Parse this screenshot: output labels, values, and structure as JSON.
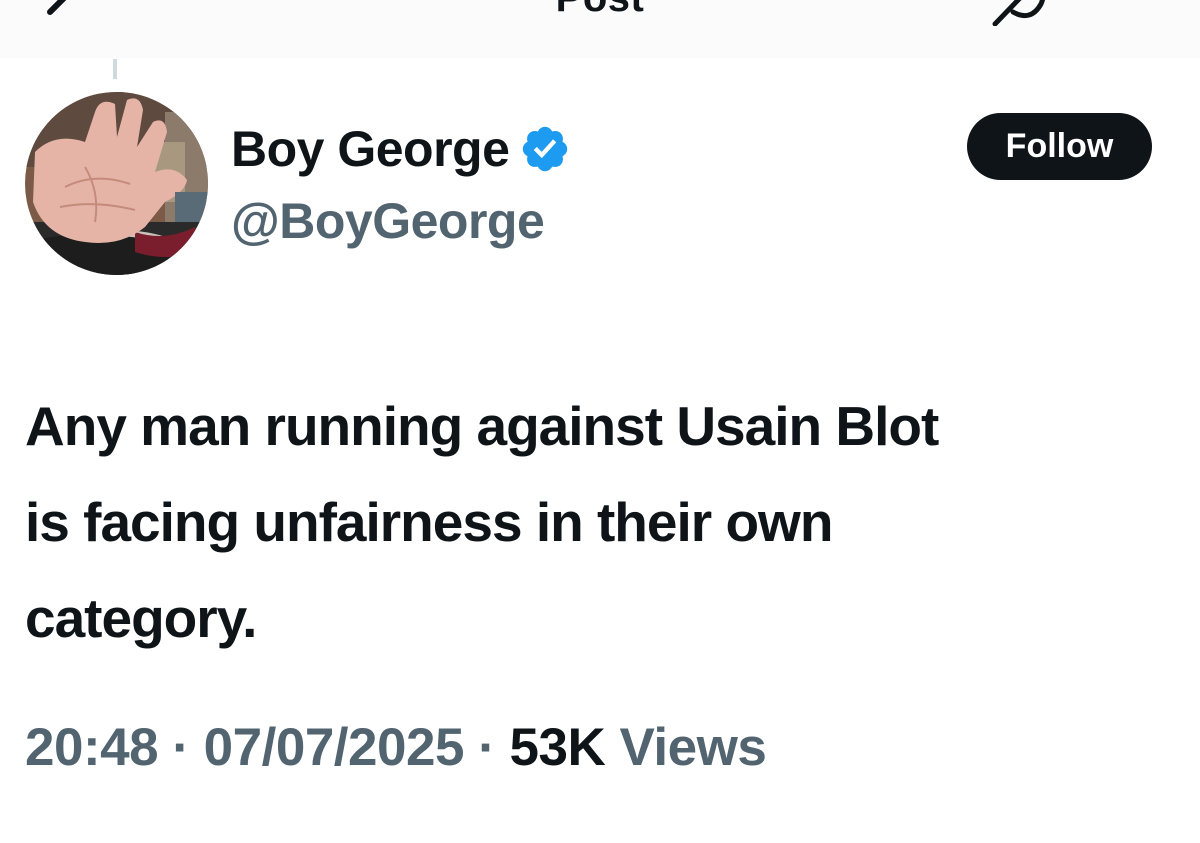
{
  "header": {
    "title": "Post",
    "back_icon": "arrow-left-icon",
    "grok_icon": "grok-icon",
    "more_icon": "more-horizontal-icon"
  },
  "author": {
    "display_name": "Boy George",
    "handle": "@BoyGeorge",
    "verified": true,
    "verified_color": "#1d9bf0",
    "avatar_description": "photo of an open palm"
  },
  "follow_button": {
    "label": "Follow"
  },
  "tweet": {
    "lines": [
      "Any man running against Usain Blot",
      "is facing unfairness in their own",
      "category."
    ]
  },
  "meta": {
    "time": "20:48",
    "separator": " · ",
    "date": "07/07/2025",
    "views_count": "53K",
    "views_label": " Views"
  },
  "colors": {
    "primary_text": "#0f1419",
    "secondary_text": "#536471",
    "follow_bg": "#0f1419",
    "accent": "#1d9bf0"
  }
}
